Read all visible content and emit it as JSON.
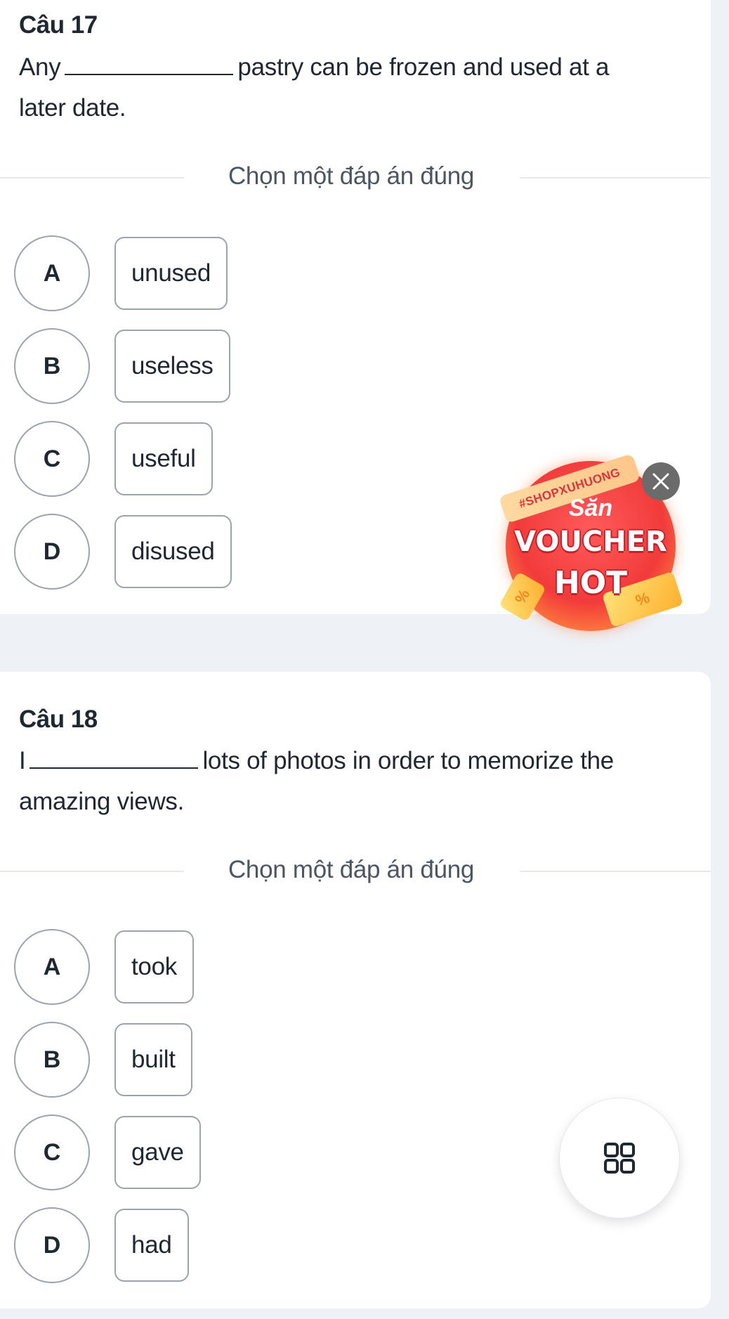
{
  "questions": [
    {
      "title": "Câu 17",
      "text_before": "Any",
      "text_after": "pastry can be frozen and used at a",
      "text_line2": "later date.",
      "instruction": "Chọn một đáp án đúng",
      "options": [
        {
          "letter": "A",
          "text": "unused"
        },
        {
          "letter": "B",
          "text": "useless"
        },
        {
          "letter": "C",
          "text": "useful"
        },
        {
          "letter": "D",
          "text": "disused"
        }
      ]
    },
    {
      "title": "Câu 18",
      "text_before": "I",
      "text_after": "lots of photos in order to memorize the",
      "text_line2": "amazing views.",
      "instruction": "Chọn một đáp án đúng",
      "options": [
        {
          "letter": "A",
          "text": "took"
        },
        {
          "letter": "B",
          "text": "built"
        },
        {
          "letter": "C",
          "text": "gave"
        },
        {
          "letter": "D",
          "text": "had"
        }
      ]
    }
  ],
  "voucher": {
    "tag": "#SHOPXUHUONG",
    "line1": "Săn",
    "line2": "VOUCHER",
    "line3": "HOT",
    "coupon_symbol": "%",
    "close_icon": "close-icon"
  },
  "fab": {
    "icon": "grid-menu-icon"
  },
  "colors": {
    "page_bg": "#eef1f5",
    "card_bg": "#ffffff",
    "text": "#1f2733",
    "muted": "#4b5563",
    "border": "#9ca3af",
    "voucher_red": "#f23b3b"
  }
}
